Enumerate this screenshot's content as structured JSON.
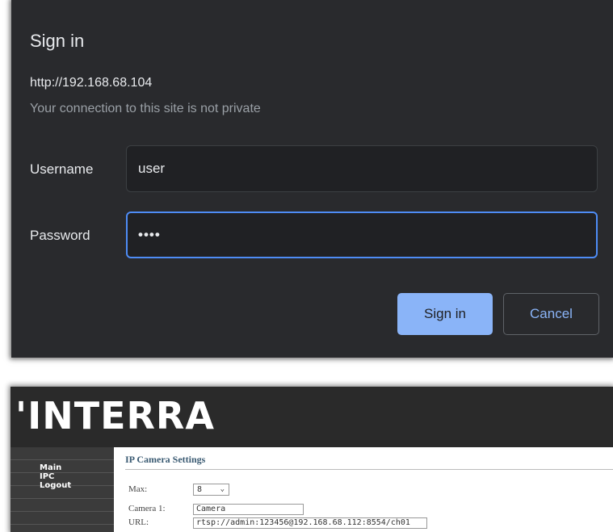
{
  "dialog": {
    "title": "Sign in",
    "origin": "http://192.168.68.104",
    "warning": "Your connection to this site is not private",
    "username_label": "Username",
    "username_value": "user",
    "password_label": "Password",
    "password_masked": "••••",
    "sign_in_label": "Sign in",
    "cancel_label": "Cancel",
    "colors": {
      "background": "#292a2d",
      "primary_button": "#8ab4f8",
      "focus_border": "#4e8cf5"
    }
  },
  "webui": {
    "logo": "'INTERRA",
    "nav": [
      {
        "label": "Main"
      },
      {
        "label": "IPC"
      },
      {
        "label": "Logout"
      }
    ],
    "section_title": "IP Camera Settings",
    "max_label": "Max:",
    "max_value": "8",
    "camera_label": "Camera 1:",
    "camera_value": "Camera",
    "url_label": "URL:",
    "url_value": "rtsp://admin:123456@192.168.68.112:8554/ch01",
    "colors": {
      "header": "#2a2a2a",
      "sidebar": "#3b3b3b",
      "title": "#3a5a72"
    }
  }
}
